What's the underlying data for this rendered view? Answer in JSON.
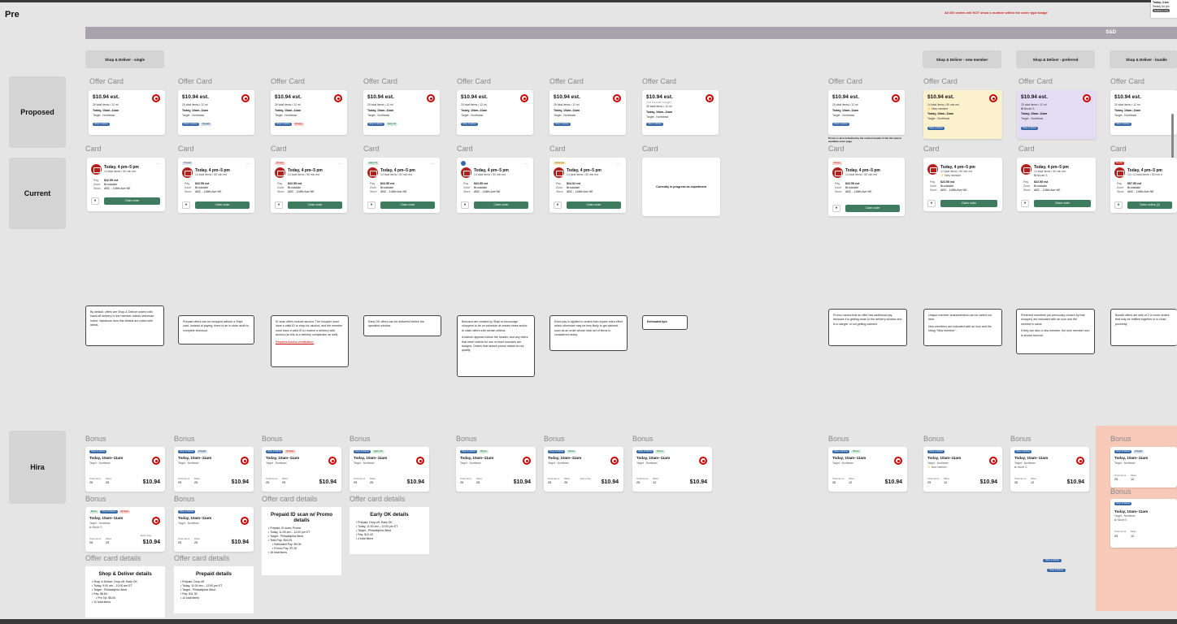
{
  "page": {
    "title": "Pre"
  },
  "header": {
    "notice": "All DG orders will NOT show a number within the order type badge"
  },
  "popup": {
    "line1": "Today, 4 am",
    "line2": "Ready for pic",
    "pill": "Delivery only"
  },
  "band": {
    "label": "S&D"
  },
  "columns": {
    "c1": "Shop & Deliver - single",
    "c9": "Shop & Deliver - new member",
    "c10": "Shop & Deliver - preferred",
    "c11": "Shop & Deliver - bundle"
  },
  "rows": {
    "proposed": "Proposed",
    "current": "Current",
    "hira": "Hira"
  },
  "labels": {
    "offer_card": "Offer Card",
    "card": "Card",
    "bonus": "Bonus",
    "offer_card_details": "Offer card details"
  },
  "offer": {
    "price": "$10.94 est.",
    "meta": "25 total items • 12 mi",
    "time": "Today, 10am–11am",
    "store": "Target - Northeast",
    "new_member_meta": "14 total items • 50 min est",
    "new_member": "New member",
    "preferred": "Nicole S.",
    "promo_badge": "Promo",
    "promo_note": "Promo is also indicated by the section header in the list view in available order page",
    "offer_placeholder": "(not included badge)",
    "badges": {
      "sd": "Shop & deliver",
      "prepaid": "Prepaid",
      "id": "ID scan",
      "earlyok": "Early OK",
      "extra": "Extra pay"
    }
  },
  "card": {
    "title": "Today, 4 pm–5 pm",
    "sub": "14 total items • 50 min est",
    "sub_alt": "14 total items • 52 min est",
    "pay_k": "Pay",
    "pay_v": "$22.55 est",
    "zone_k": "Zone",
    "zone_v": "Brookdale",
    "store_k": "Store",
    "store_v": "ABC - 148th Ave NE",
    "pay_extra": "$24.02 est",
    "pay_bundle": "$57.55 est",
    "claim": "Claim order",
    "claim_bundle": "Claim orders (3)",
    "badge_prepaid": "Prepaid",
    "badge_id": "ID scan",
    "badge_earlyok": "Early OK",
    "badge_extra": "Extra pay",
    "badge_promo": "Promo",
    "badge_bundle": "Bundle",
    "bundle_sub": "14 • 11 total items • 50 min e",
    "experiment": "Currently in progress as experiment"
  },
  "notes": [
    "By default, offers are Shop & Deliver orders with hand-off delivery to the member unless otherwise noted. Variations from this default are noted with labels.",
    "Prepaid offers can be shopped without a Shipt card. Instead of paying, there is an in-store audit to complete checkout.",
    "ID scan offers include alcohol. The shopper must have a valid ID to shop for alcohol, and the member must have a valid ID to receive a delivery with alcohol (so this is a delivery complicator as well).",
    "Requires Alcohol certification.",
    "Early OK offers can be delivered before the specified window.",
    "Bonuses are created by Shipt to encourage shoppers to be on schedule at certain times and/or to claim offers with certain criteria.",
    "A banner appears below the header, and any offers that meet criteria for one or more bonuses are badged. Orders that search promo status do not qualify.",
    "Extra pay is applied to orders that require extra effort which otherwise may be less likely to get claimed, such as an order whose total set of items is considered heavy.",
    "Estimated tips",
    "Promo means that an offer has additional pay because it is getting close to the delivery window and is in danger of not getting claimed.",
    "Unique member characteristics can be called out here.",
    "New members are indicated with an icon and the string \"New member\".",
    "Preferred members (as previously chosen by that shopper) are indicated with an icon and the member's name.",
    "If they are also a new member, the new member icon is shown second.",
    "Bundle offers are sets of 2 or more orders that may be fulfilled together or in close proximity."
  ],
  "bonus": {
    "time": "Today, 10am–11am",
    "store": "Target - Northeast",
    "k_items": "Total items",
    "k_miles": "Miles",
    "k_extra": "Extra Pay",
    "v_items": "25",
    "v_miles": "25",
    "v_miles2": "12",
    "price": "$10.94",
    "badges": {
      "sd": "Shop & Deliver",
      "prepaid": "Prepaid",
      "id": "ID Scan",
      "earlyok": "Early OK",
      "bonus": "Bonus",
      "new": "New member",
      "pref": "Preferred"
    }
  },
  "details": [
    {
      "title": "Shop & Deliver details",
      "items": [
        "Shop & Deliver, Drop-off, Early OK",
        "Today, 9:00 am – 10:00 am ET",
        "Target - Philadelphia West",
        "Pay: $6.84",
        "Pre Tip: $5.00",
        "12 total items"
      ]
    },
    {
      "title": "Prepaid details",
      "items": [
        "Prepaid, Drop-off",
        "Today, 11:00 am – 12:00 pm ET",
        "Target - Philadelphia West",
        "Pay: $11.30",
        "14 total items"
      ]
    },
    {
      "title": "Prepaid ID scan w/ Promo details",
      "items": [
        "Prepaid, ID scan, Promo",
        "Today, 11:00 am – 12:00 pm ET",
        "Target - Philadelphia West",
        "Total Pay: $16.05",
        "Estimated Pay: $9.05",
        "Promo Pay: $7.00",
        "16 total items"
      ]
    },
    {
      "title": "Early OK details",
      "items": [
        "Prepaid, Drop-off, Early OK",
        "Today, 11:00 am – 12:00 pm ET",
        "Target - Philadelphia West",
        "Pay: $12.42",
        "4 total items"
      ]
    }
  ],
  "floating": {
    "a": "Shop & Deliver",
    "b": "Shop & Deliver"
  }
}
